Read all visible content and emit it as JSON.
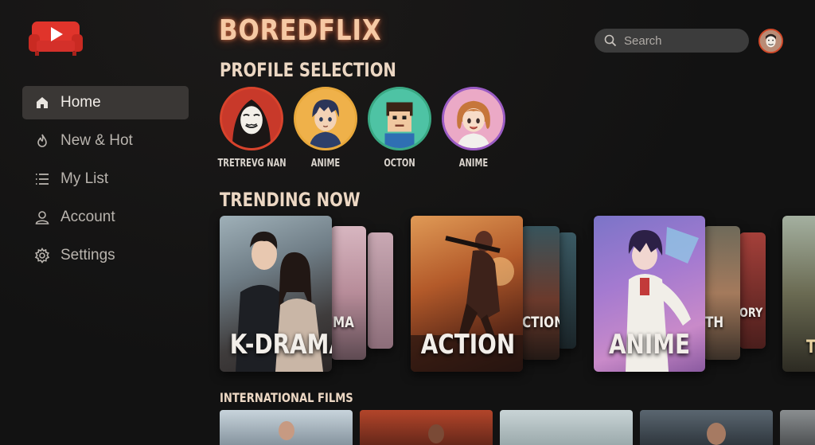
{
  "app": {
    "brand": "BOREDFLIX"
  },
  "sidebar": {
    "items": [
      {
        "label": "Home",
        "icon": "home-icon",
        "active": true
      },
      {
        "label": "New & Hot",
        "icon": "flame-icon",
        "active": false
      },
      {
        "label": "My List",
        "icon": "list-icon",
        "active": false
      },
      {
        "label": "Account",
        "icon": "user-icon",
        "active": false
      },
      {
        "label": "Settings",
        "icon": "gear-icon",
        "active": false
      }
    ]
  },
  "search": {
    "placeholder": "Search"
  },
  "profiles": {
    "title": "PROFILE SELECTION",
    "items": [
      {
        "name": "TRETREVG NAN",
        "ring_color": "#d8432c"
      },
      {
        "name": "ANIME",
        "ring_color": "#e8a83b"
      },
      {
        "name": "OCTON",
        "ring_color": "#3aa984"
      },
      {
        "name": "ANIME",
        "ring_color": "#9b5cc4"
      }
    ]
  },
  "trending": {
    "title": "TRENDING NOW",
    "groups": [
      {
        "main": "K-DRAMA",
        "stack_labels": [
          "MA"
        ]
      },
      {
        "main": "ACTION",
        "stack_labels": [
          "CTION"
        ]
      },
      {
        "main": "ANIME",
        "stack_labels": [
          "TH",
          "ORY"
        ]
      },
      {
        "main": "",
        "stack_labels": [
          "T"
        ]
      }
    ]
  },
  "international": {
    "title": "INTERNATIONAL FILMS"
  },
  "colors": {
    "accent": "#e8362c",
    "brand_glow": "#ff7a45",
    "background": "#121212"
  }
}
